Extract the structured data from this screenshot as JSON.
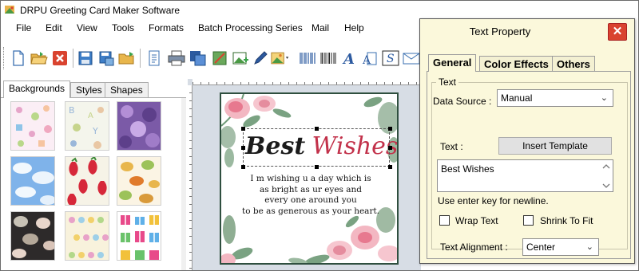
{
  "window": {
    "title": "DRPU Greeting Card Maker Software"
  },
  "menu": [
    "File",
    "Edit",
    "View",
    "Tools",
    "Formats",
    "Batch Processing Series",
    "Mail",
    "Help"
  ],
  "toolbar": {
    "buttons": [
      "new-icon",
      "open-icon",
      "close-icon",
      "save-icon",
      "save-as-icon",
      "export-icon",
      "properties-icon",
      "print-icon",
      "print-preview-icon",
      "send-to-back-icon",
      "image-icon",
      "pen-icon",
      "picture-icon",
      "barcode-icon",
      "text-icon",
      "wordart-icon",
      "signature-icon",
      "mail-icon"
    ]
  },
  "left_tabs": [
    "Backgrounds",
    "Styles",
    "Shapes"
  ],
  "thumbnails": [
    "baby-pattern",
    "baby-letters-pattern",
    "purple-floral-pattern",
    "blue-sky-pattern",
    "strawberry-pattern",
    "leaf-pattern",
    "dark-leaf-pattern",
    "balloon-pattern",
    "gift-box-pattern"
  ],
  "card": {
    "title_part1": "Best",
    "title_part2": "Wishes",
    "message": [
      "I m wishing u a day which is",
      "as bright as ur eyes and",
      "every one around you",
      "to be as generous as your heart."
    ]
  },
  "dialog": {
    "title": "Text Property",
    "close": "✕",
    "tabs": [
      "General",
      "Color Effects",
      "Others"
    ],
    "group_label": "Text",
    "data_source_label": "Data Source :",
    "data_source_value": "Manual",
    "text_label": "Text :",
    "insert_template": "Insert Template",
    "text_value": "Best Wishes",
    "hint": "Use enter key for newline.",
    "wrap_text": "Wrap Text",
    "shrink_to_fit": "Shrink To Fit",
    "alignment_label": "Text Alignment :",
    "alignment_value": "Center"
  },
  "colors": {
    "accent_red": "#d9432f",
    "dialog_bg": "#fbf8db",
    "card_title_red": "#c2314a"
  }
}
